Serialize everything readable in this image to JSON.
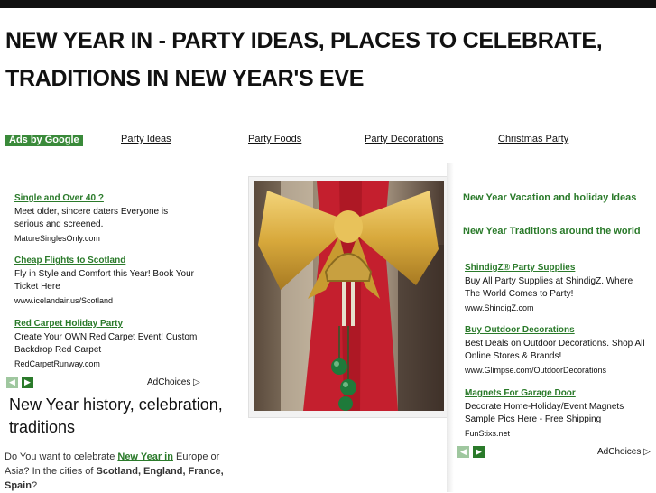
{
  "page": {
    "title": "NEW YEAR IN - PARTY IDEAS, PLACES TO CELEBRATE, TRADITIONS IN NEW YEAR'S EVE"
  },
  "nav": {
    "ads_label": "Ads by Google",
    "links": [
      "Party Ideas",
      "Party Foods",
      "Party Decorations",
      "Christmas Party"
    ]
  },
  "left_ads": [
    {
      "title": "Single and Over 40 ?",
      "desc": "Meet older, sincere daters Everyone is serious and screened.",
      "url": "MatureSinglesOnly.com"
    },
    {
      "title": "Cheap Flights to Scotland",
      "desc": "Fly in Style and Comfort this Year! Book Your Ticket Here",
      "url": "www.icelandair.us/Scotland"
    },
    {
      "title": "Red Carpet Holiday Party",
      "desc": "Create Your OWN Red Carpet Event! Custom Backdrop Red Carpet",
      "url": "RedCarpetRunway.com"
    }
  ],
  "adchoices_label": "AdChoices",
  "arrows": {
    "prev": "◀",
    "next": "▶"
  },
  "article": {
    "heading": "New Year history, celebration, traditions",
    "intro_prefix": "Do You want to celebrate ",
    "intro_link": "New Year in",
    "intro_mid": " Europe or Asia? In the cities of ",
    "intro_cities": "Scotland, England, France, Spain",
    "intro_suffix": "?"
  },
  "right_links": [
    "New Year Vacation and holiday Ideas",
    "New Year Traditions around the world"
  ],
  "right_ads": [
    {
      "title": "ShindigZ® Party Supplies",
      "desc": "Buy All Party Supplies at ShindigZ. Where The World Comes to Party!",
      "url": "www.ShindigZ.com"
    },
    {
      "title": "Buy Outdoor Decorations",
      "desc": "Best Deals on Outdoor Decorations. Shop All Online Stores & Brands!",
      "url": "www.Glimpse.com/OutdoorDecorations"
    },
    {
      "title": "Magnets For Garage Door",
      "desc": "Decorate Home-Holiday/Event Magnets Sample Pics Here - Free Shipping",
      "url": "FunStixs.net"
    }
  ],
  "colors": {
    "link_green": "#2a7a2a",
    "ads_bg": "#3a8a3a",
    "topbar": "#111111"
  }
}
